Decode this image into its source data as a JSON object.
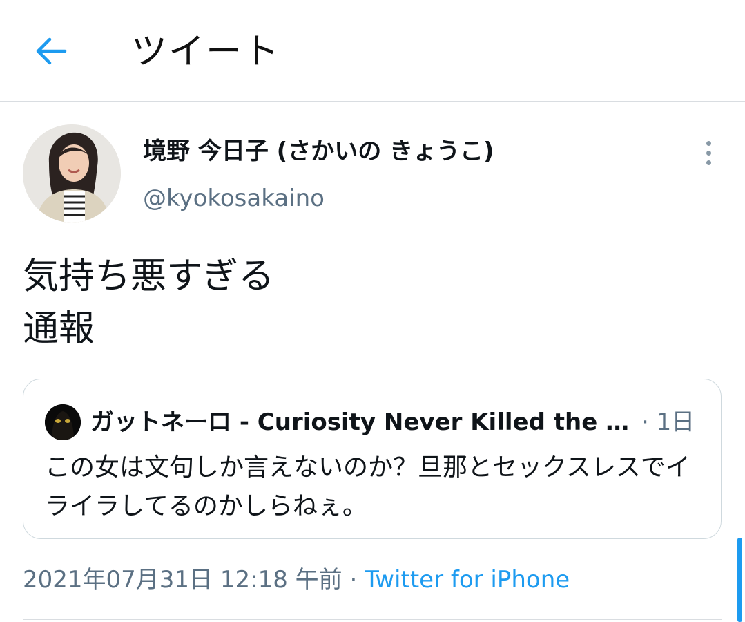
{
  "header": {
    "title": "ツイート",
    "back_icon": "arrow-left-icon",
    "accent": "#1d9bf0"
  },
  "tweet": {
    "author": {
      "display_name": "境野 今日子 (さかいの きょうこ)",
      "handle": "@kyokosakaino"
    },
    "text_lines": [
      "気持ち悪すぎる",
      "通報"
    ],
    "more_icon": "more-vertical-icon",
    "quoted": {
      "author_name": "ガットネーロ - Curiosity Never Killed the Cat",
      "time": "· 1日",
      "text": "この女は文句しか言えないのか？旦那とセックスレスでイライラしてるのかしらねぇ。"
    },
    "meta": {
      "datetime": "2021年07月31日 12:18 午前",
      "separator": " · ",
      "source": "Twitter for iPhone"
    }
  }
}
